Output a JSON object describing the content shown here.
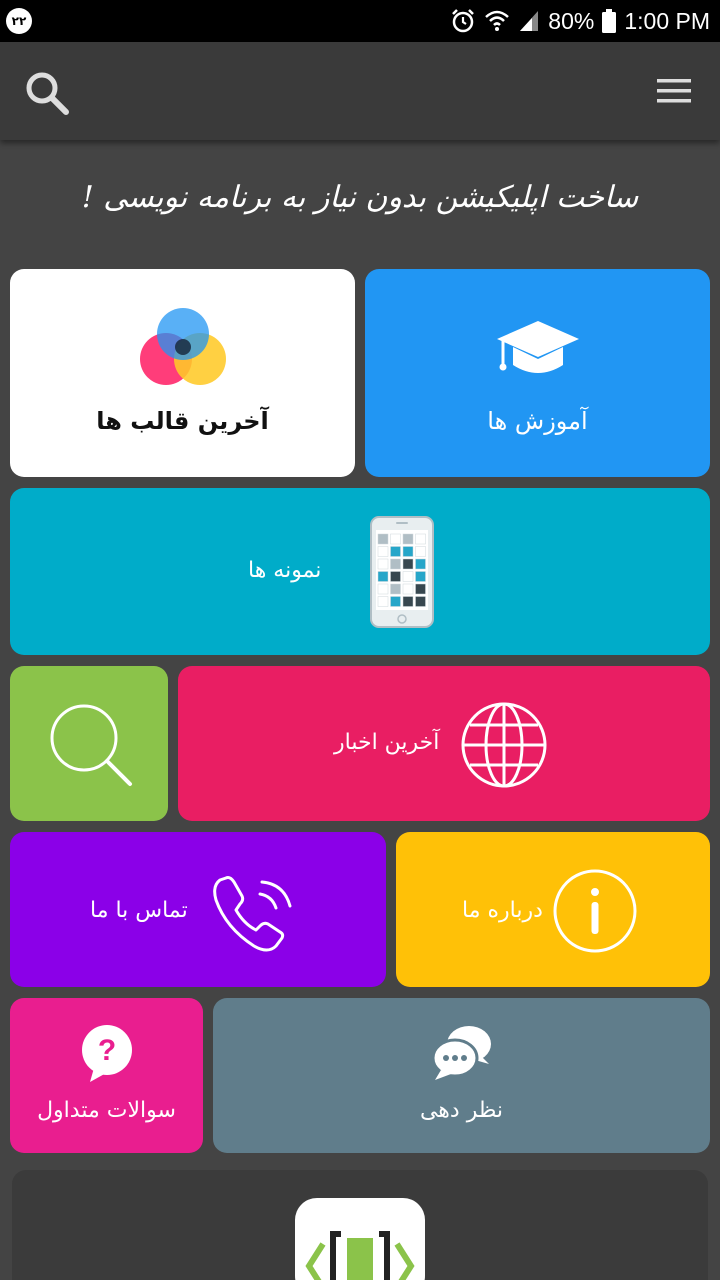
{
  "status_bar": {
    "notification_badge": "۲۲",
    "battery": "80%",
    "time": "1:00 PM"
  },
  "tagline": "ساخت اپلیکیشن بدون نیاز به برنامه نویسی !",
  "tiles": {
    "tutorials": {
      "label": "آموزش ها",
      "color": "#2196f3",
      "icon": "graduation-cap-icon"
    },
    "templates": {
      "label": "آخرین قالب ها",
      "color": "#ffffff",
      "icon": "color-circles-icon"
    },
    "samples": {
      "label": "نمونه ها",
      "color": "#00acc9",
      "icon": "smartphone-icon"
    },
    "search": {
      "color": "#8bc34a",
      "icon": "search-icon"
    },
    "news": {
      "label": "آخرین اخبار",
      "color": "#e91e63",
      "icon": "globe-icon"
    },
    "contact": {
      "label": "تماس با ما",
      "color": "#8b00e8",
      "icon": "phone-icon"
    },
    "about": {
      "label": "درباره ما",
      "color": "#ffc107",
      "icon": "info-icon"
    },
    "faq": {
      "label": "سوالات متداول",
      "color": "#e91e8f",
      "icon": "question-bubble-icon"
    },
    "feedback": {
      "label": "نظر دهی",
      "color": "#607d8b",
      "icon": "chat-bubbles-icon"
    }
  },
  "bottom_logo": {
    "icon": "code-brackets-logo-icon"
  }
}
